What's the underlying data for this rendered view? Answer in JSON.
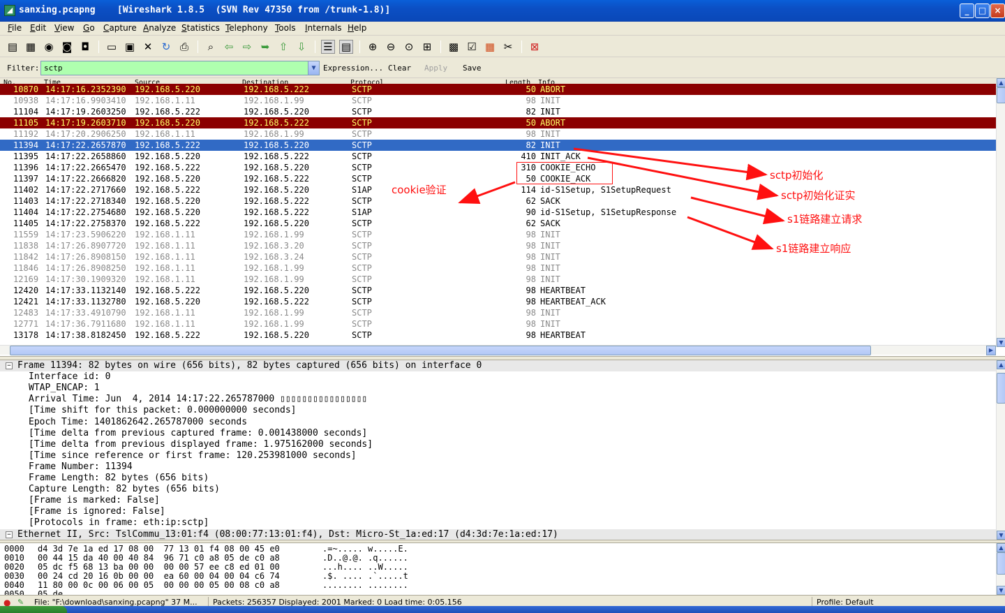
{
  "window": {
    "title": "sanxing.pcapng    [Wireshark 1.8.5  (SVN Rev 47350 from /trunk-1.8)]",
    "min": "_",
    "max": "□",
    "close": "×"
  },
  "menu": [
    "File",
    "Edit",
    "View",
    "Go",
    "Capture",
    "Analyze",
    "Statistics",
    "Telephony",
    "Tools",
    "Internals",
    "Help"
  ],
  "toolbar_icons": [
    "interface-list-icon",
    "capture-options-icon",
    "start-capture-icon",
    "stop-capture-icon",
    "restart-capture-icon",
    "open-file-icon",
    "save-file-icon",
    "close-file-icon",
    "reload-icon",
    "print-icon",
    "find-packet-icon",
    "go-back-icon",
    "go-forward-icon",
    "go-to-packet-icon",
    "go-first-icon",
    "go-last-icon",
    "colorize-icon",
    "autoscroll-icon",
    "zoom-in-icon",
    "zoom-out-icon",
    "zoom-normal-icon",
    "resize-columns-icon",
    "capture-filters-icon",
    "display-filters-icon",
    "coloring-rules-icon",
    "preferences-icon",
    "help-icon"
  ],
  "filter": {
    "label": "Filter:",
    "value": "sctp",
    "expression": "Expression...",
    "clear": "Clear",
    "apply": "Apply",
    "save": "Save"
  },
  "columns": {
    "no": "No.",
    "time": "Time",
    "source": "Source",
    "destination": "Destination",
    "protocol": "Protocol",
    "length": "Length",
    "info": "Info"
  },
  "packets": [
    {
      "no": "10870",
      "time": "14:17:16.2352390",
      "src": "192.168.5.220",
      "dst": "192.168.5.222",
      "proto": "SCTP",
      "len": "50",
      "info": "ABORT",
      "style": "abort"
    },
    {
      "no": "10938",
      "time": "14:17:16.9903410",
      "src": "192.168.1.11",
      "dst": "192.168.1.99",
      "proto": "SCTP",
      "len": "98",
      "info": "INIT",
      "style": "grey"
    },
    {
      "no": "11104",
      "time": "14:17:19.2603250",
      "src": "192.168.5.222",
      "dst": "192.168.5.220",
      "proto": "SCTP",
      "len": "82",
      "info": "INIT",
      "style": "normal"
    },
    {
      "no": "11105",
      "time": "14:17:19.2603710",
      "src": "192.168.5.220",
      "dst": "192.168.5.222",
      "proto": "SCTP",
      "len": "50",
      "info": "ABORT",
      "style": "abort"
    },
    {
      "no": "11192",
      "time": "14:17:20.2906250",
      "src": "192.168.1.11",
      "dst": "192.168.1.99",
      "proto": "SCTP",
      "len": "98",
      "info": "INIT",
      "style": "grey"
    },
    {
      "no": "11394",
      "time": "14:17:22.2657870",
      "src": "192.168.5.222",
      "dst": "192.168.5.220",
      "proto": "SCTP",
      "len": "82",
      "info": "INIT",
      "style": "selected"
    },
    {
      "no": "11395",
      "time": "14:17:22.2658860",
      "src": "192.168.5.220",
      "dst": "192.168.5.222",
      "proto": "SCTP",
      "len": "410",
      "info": "INIT_ACK",
      "style": "normal"
    },
    {
      "no": "11396",
      "time": "14:17:22.2665470",
      "src": "192.168.5.222",
      "dst": "192.168.5.220",
      "proto": "SCTP",
      "len": "310",
      "info": "COOKIE_ECHO",
      "style": "normal"
    },
    {
      "no": "11397",
      "time": "14:17:22.2666820",
      "src": "192.168.5.220",
      "dst": "192.168.5.222",
      "proto": "SCTP",
      "len": "50",
      "info": "COOKIE_ACK",
      "style": "normal"
    },
    {
      "no": "11402",
      "time": "14:17:22.2717660",
      "src": "192.168.5.222",
      "dst": "192.168.5.220",
      "proto": "S1AP",
      "len": "114",
      "info": "id-S1Setup, S1SetupRequest",
      "style": "normal"
    },
    {
      "no": "11403",
      "time": "14:17:22.2718340",
      "src": "192.168.5.220",
      "dst": "192.168.5.222",
      "proto": "SCTP",
      "len": "62",
      "info": "SACK",
      "style": "normal"
    },
    {
      "no": "11404",
      "time": "14:17:22.2754680",
      "src": "192.168.5.220",
      "dst": "192.168.5.222",
      "proto": "S1AP",
      "len": "90",
      "info": "id-S1Setup, S1SetupResponse",
      "style": "normal"
    },
    {
      "no": "11405",
      "time": "14:17:22.2758370",
      "src": "192.168.5.222",
      "dst": "192.168.5.220",
      "proto": "SCTP",
      "len": "62",
      "info": "SACK",
      "style": "normal"
    },
    {
      "no": "11559",
      "time": "14:17:23.5906220",
      "src": "192.168.1.11",
      "dst": "192.168.1.99",
      "proto": "SCTP",
      "len": "98",
      "info": "INIT",
      "style": "grey"
    },
    {
      "no": "11838",
      "time": "14:17:26.8907720",
      "src": "192.168.1.11",
      "dst": "192.168.3.20",
      "proto": "SCTP",
      "len": "98",
      "info": "INIT",
      "style": "grey"
    },
    {
      "no": "11842",
      "time": "14:17:26.8908150",
      "src": "192.168.1.11",
      "dst": "192.168.3.24",
      "proto": "SCTP",
      "len": "98",
      "info": "INIT",
      "style": "grey"
    },
    {
      "no": "11846",
      "time": "14:17:26.8908250",
      "src": "192.168.1.11",
      "dst": "192.168.1.99",
      "proto": "SCTP",
      "len": "98",
      "info": "INIT",
      "style": "grey"
    },
    {
      "no": "12169",
      "time": "14:17:30.1909320",
      "src": "192.168.1.11",
      "dst": "192.168.1.99",
      "proto": "SCTP",
      "len": "98",
      "info": "INIT",
      "style": "grey"
    },
    {
      "no": "12420",
      "time": "14:17:33.1132140",
      "src": "192.168.5.222",
      "dst": "192.168.5.220",
      "proto": "SCTP",
      "len": "98",
      "info": "HEARTBEAT",
      "style": "normal"
    },
    {
      "no": "12421",
      "time": "14:17:33.1132780",
      "src": "192.168.5.220",
      "dst": "192.168.5.222",
      "proto": "SCTP",
      "len": "98",
      "info": "HEARTBEAT_ACK",
      "style": "normal"
    },
    {
      "no": "12483",
      "time": "14:17:33.4910790",
      "src": "192.168.1.11",
      "dst": "192.168.1.99",
      "proto": "SCTP",
      "len": "98",
      "info": "INIT",
      "style": "grey"
    },
    {
      "no": "12771",
      "time": "14:17:36.7911680",
      "src": "192.168.1.11",
      "dst": "192.168.1.99",
      "proto": "SCTP",
      "len": "98",
      "info": "INIT",
      "style": "grey"
    },
    {
      "no": "13178",
      "time": "14:17:38.8182450",
      "src": "192.168.5.222",
      "dst": "192.168.5.220",
      "proto": "SCTP",
      "len": "98",
      "info": "HEARTBEAT",
      "style": "normal"
    }
  ],
  "annotations": {
    "cookie": "cookie验证",
    "init": "sctp初始化",
    "init_ack": "sctp初始化证实",
    "setup_req": "s1链路建立请求",
    "setup_rsp": "s1链路建立响应",
    "color": "#ff1010"
  },
  "details": [
    {
      "text": "Frame 11394: 82 bytes on wire (656 bits), 82 bytes captured (656 bits) on interface 0",
      "expander": "⊟",
      "top": true
    },
    {
      "text": "Interface id: 0"
    },
    {
      "text": "WTAP_ENCAP: 1"
    },
    {
      "text": "Arrival Time: Jun  4, 2014 14:17:22.265787000 ▯▯▯▯▯▯▯▯▯▯▯▯▯▯▯▯"
    },
    {
      "text": "[Time shift for this packet: 0.000000000 seconds]"
    },
    {
      "text": "Epoch Time: 1401862642.265787000 seconds"
    },
    {
      "text": "[Time delta from previous captured frame: 0.001438000 seconds]"
    },
    {
      "text": "[Time delta from previous displayed frame: 1.975162000 seconds]"
    },
    {
      "text": "[Time since reference or first frame: 120.253981000 seconds]"
    },
    {
      "text": "Frame Number: 11394"
    },
    {
      "text": "Frame Length: 82 bytes (656 bits)"
    },
    {
      "text": "Capture Length: 82 bytes (656 bits)"
    },
    {
      "text": "[Frame is marked: False]"
    },
    {
      "text": "[Frame is ignored: False]"
    },
    {
      "text": "[Protocols in frame: eth:ip:sctp]"
    },
    {
      "text": "Ethernet II, Src: TslCommu_13:01:f4 (08:00:77:13:01:f4), Dst: Micro-St_1a:ed:17 (d4:3d:7e:1a:ed:17)",
      "expander": "⊟",
      "top": true
    }
  ],
  "bytes": [
    {
      "offset": "0000",
      "hex": "d4 3d 7e 1a ed 17 08 00  77 13 01 f4 08 00 45 e0",
      "ascii": ".=~..... w.....E."
    },
    {
      "offset": "0010",
      "hex": "00 44 15 da 40 00 40 84  96 71 c0 a8 05 de c0 a8",
      "ascii": ".D..@.@. .q......"
    },
    {
      "offset": "0020",
      "hex": "05 dc f5 68 13 ba 00 00  00 00 57 ee c8 ed 01 00",
      "ascii": "...h.... ..W....."
    },
    {
      "offset": "0030",
      "hex": "00 24 cd 20 16 0b 00 00  ea 60 00 04 00 04 c6 74",
      "ascii": ".$. .... .`.....t"
    },
    {
      "offset": "0040",
      "hex": "11 80 00 0c 00 06 00 05  00 00 00 05 00 08 c0 a8",
      "ascii": "........ ........"
    },
    {
      "offset": "0050",
      "hex": "05 de",
      "ascii": ""
    }
  ],
  "status": {
    "file": "File: \"F:\\download\\sanxing.pcapng\" 37 M...",
    "packets": "Packets: 256357 Displayed: 2001 Marked: 0 Load time: 0:05.156",
    "profile": "Profile: Default"
  }
}
